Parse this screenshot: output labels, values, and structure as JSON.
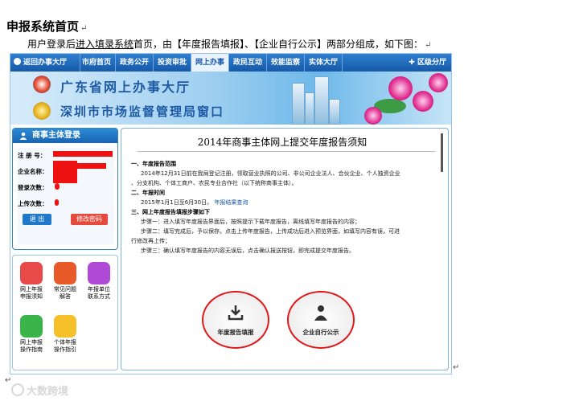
{
  "doc": {
    "title": "申报系统首页",
    "intro_prefix": "用户登录后",
    "intro_underlined": "进入填录系统",
    "intro_suffix": "首页，由【年度报告填报】、【企业自行公示】两部分组成，如下图：",
    "para_mark": "↵"
  },
  "nav": {
    "home": "返回办事大厅",
    "items": [
      "市府首页",
      "政务公开",
      "投资审批",
      "网上办事",
      "政民互动",
      "效能监察",
      "实体大厅"
    ],
    "active_index": 3,
    "region": "区级分厅"
  },
  "banner": {
    "line1": "广东省网上办事大厅",
    "line2": "深圳市市场监督管理局窗口"
  },
  "login": {
    "title": "商事主体登录",
    "fields": [
      "注 册 号：",
      "企业名称：",
      "登录次数：",
      "上传次数："
    ],
    "logout_label": "退 出",
    "change_pwd_label": "修改密码"
  },
  "apps": [
    {
      "label1": "网上年报",
      "label2": "申报须知",
      "icon": "location-pin-icon",
      "color": "#e84a4a"
    },
    {
      "label1": "常见问题",
      "label2": "解答",
      "icon": "monitor-icon",
      "color": "#e85a2a"
    },
    {
      "label1": "年报单位",
      "label2": "联系方式",
      "icon": "tablet-icon",
      "color": "#b04ad6"
    },
    {
      "label1": "网上申报",
      "label2": "操作指南",
      "icon": "video-icon",
      "color": "#38b449"
    },
    {
      "label1": "个体年报",
      "label2": "操作指引",
      "icon": "book-icon",
      "color": "#f5c02a"
    }
  ],
  "content": {
    "title": "2014年商事主体网上提交年度报告须知",
    "s1_head": "一、年度报告范围",
    "s1_text1": "2014年12月31日前在我局登记注册，领取营业执照的公司、非公司企业法人、合伙企业、个人独资企业",
    "s1_text2": "、分支机构、个体工商户、农民专业合作社（以下统称商事主体）。",
    "s2_head": "二、年报时间",
    "s2_text": "2015年1月1日至6月30日。",
    "s2_link": "年报结果查询",
    "s3_head": "三、网上年度报告填报步骤如下",
    "step1": "步骤一：进入填写年度报告界面后，按照提示下载年度报告，离线填写年度报告的内容；",
    "step2a": "步骤二：填写完成后，予以保存。点击上传年度报告，上传成功后进入预览界面，如填写内容有误，可进",
    "step2b": "行修改再上传；",
    "step3": "步骤三：确认填写年度报告的内容无误后，点击确认报送按钮，即完成提交年度报告。",
    "btn_fill": "年度报告填报",
    "btn_publish": "企业自行公示"
  },
  "watermark": "大数跨境"
}
